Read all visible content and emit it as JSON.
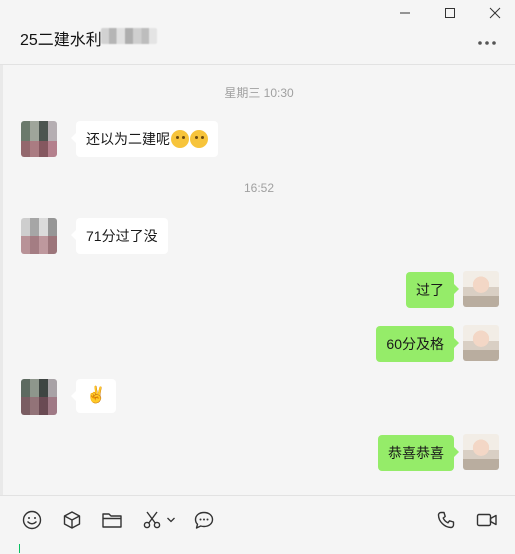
{
  "window": {
    "title": "25二建水利",
    "controls": [
      "minimize-icon",
      "maximize-icon",
      "close-icon"
    ]
  },
  "header": {
    "more_icon": "ellipsis-icon"
  },
  "messages": {
    "time1": "星期三 10:30",
    "msg1": "还以为二建呢",
    "time2": "16:52",
    "msg2": "71分过了没",
    "msg3": "过了",
    "msg4": "60分及格",
    "msg5_emoji": "✌️",
    "msg6": "恭喜恭喜"
  },
  "toolbar": {
    "icons": [
      "emoji-icon",
      "package-icon",
      "folder-icon",
      "scissors-icon",
      "chevron-down-icon",
      "chat-bubble-icon",
      "phone-icon",
      "video-icon"
    ]
  },
  "colors": {
    "background": "#f5f5f5",
    "bubble_out": "#95ec69",
    "bubble_in": "#ffffff",
    "cursor": "#07c160"
  }
}
